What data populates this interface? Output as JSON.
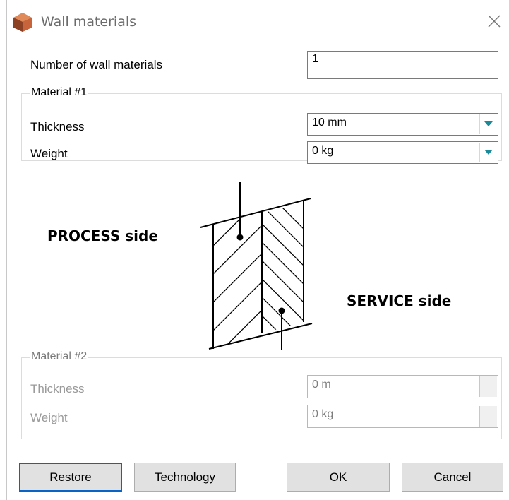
{
  "window": {
    "title": "Wall materials"
  },
  "fields": {
    "num_materials_label": "Number of wall materials",
    "num_materials_value": "1"
  },
  "material1": {
    "legend": "Material #1",
    "thickness_label": "Thickness",
    "thickness_value": "10 mm",
    "weight_label": "Weight",
    "weight_value": "0 kg"
  },
  "diagram": {
    "process_label": "PROCESS side",
    "service_label": "SERVICE side"
  },
  "material2": {
    "legend": "Material #2",
    "thickness_label": "Thickness",
    "thickness_value": "0 m",
    "weight_label": "Weight",
    "weight_value": "0 kg"
  },
  "buttons": {
    "restore": "Restore",
    "technology": "Technology",
    "ok": "OK",
    "cancel": "Cancel"
  },
  "icons": {
    "app": "app-logo-icon",
    "close": "close-icon",
    "dropdown": "dropdown-arrow-icon"
  },
  "colors": {
    "accent_arrow": "#1a8a9a",
    "default_button_border": "#0a64c8",
    "logo": "#c8643c"
  }
}
